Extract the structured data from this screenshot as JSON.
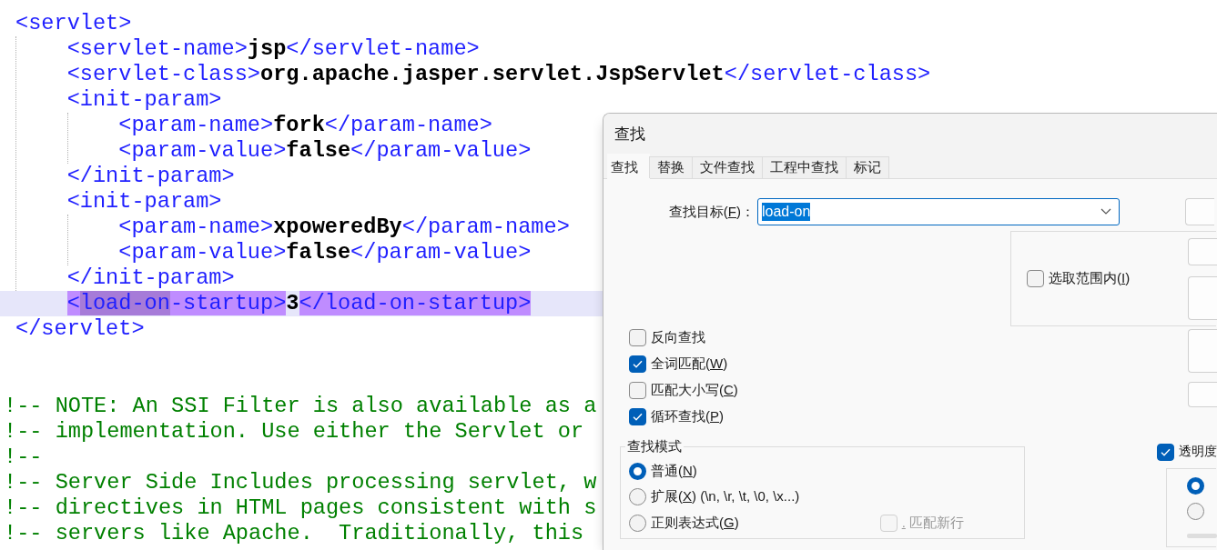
{
  "editor": {
    "lines": [
      {
        "current": false,
        "segments": [
          {
            "kind": "tag",
            "text": "<servlet>"
          }
        ],
        "children": [
          {
            "current": false,
            "segments": [
              {
                "kind": "tag",
                "text": "<servlet-name>"
              },
              {
                "kind": "value",
                "text": "jsp"
              },
              {
                "kind": "tag",
                "text": "</servlet-name>"
              }
            ]
          },
          {
            "current": false,
            "segments": [
              {
                "kind": "tag",
                "text": "<servlet-class>"
              },
              {
                "kind": "value",
                "text": "org.apache.jasper.servlet.JspServlet"
              },
              {
                "kind": "tag",
                "text": "</servlet-class>"
              }
            ]
          },
          {
            "current": false,
            "segments": [
              {
                "kind": "tag",
                "text": "<init-param>"
              }
            ],
            "children": [
              {
                "current": false,
                "segments": [
                  {
                    "kind": "tag",
                    "text": "<param-name>"
                  },
                  {
                    "kind": "value",
                    "text": "fork"
                  },
                  {
                    "kind": "tag",
                    "text": "</param-name>"
                  }
                ]
              },
              {
                "current": false,
                "segments": [
                  {
                    "kind": "tag",
                    "text": "<param-value>"
                  },
                  {
                    "kind": "value",
                    "text": "false"
                  },
                  {
                    "kind": "tag",
                    "text": "</param-value>"
                  }
                ]
              }
            ]
          },
          {
            "current": false,
            "segments": [
              {
                "kind": "tag",
                "text": "</init-param>"
              }
            ]
          },
          {
            "current": false,
            "segments": [
              {
                "kind": "tag",
                "text": "<init-param>"
              }
            ],
            "children": [
              {
                "current": false,
                "segments": [
                  {
                    "kind": "tag",
                    "text": "<param-name>"
                  },
                  {
                    "kind": "value",
                    "text": "xpoweredBy"
                  },
                  {
                    "kind": "tag",
                    "text": "</param-name>"
                  }
                ]
              },
              {
                "current": false,
                "segments": [
                  {
                    "kind": "tag",
                    "text": "<param-value>"
                  },
                  {
                    "kind": "value",
                    "text": "false"
                  },
                  {
                    "kind": "tag",
                    "text": "</param-value>"
                  }
                ]
              }
            ]
          },
          {
            "current": false,
            "segments": [
              {
                "kind": "tag",
                "text": "</init-param>"
              }
            ]
          },
          {
            "current": true,
            "segments": [
              {
                "kind": "tag",
                "text": "<",
                "highlighted": true,
                "current_match": false
              },
              {
                "kind": "tag",
                "text": "load-on",
                "highlighted": true,
                "current_match": true
              },
              {
                "kind": "tag",
                "text": "-startup>",
                "highlighted": true,
                "current_match": false
              },
              {
                "kind": "value",
                "text": "3",
                "highlighted": false,
                "current_match": false
              },
              {
                "kind": "tag",
                "text": "</load-on-startup>",
                "highlighted": true,
                "current_match": false
              }
            ]
          }
        ]
      },
      {
        "current": false,
        "segments": [
          {
            "kind": "tag",
            "text": "</servlet>"
          }
        ]
      }
    ],
    "comment_lines": [
      "!-- NOTE: An SSI Filter is also available as a",
      "!-- implementation. Use either the Servlet or",
      "!--",
      "!-- Server Side Includes processing servlet, w",
      "!-- directives in HTML pages consistent with s",
      "!-- servers like Apache.  Traditionally, this"
    ]
  },
  "dialog": {
    "title": "查找",
    "tabs": [
      {
        "label": "查找",
        "selected": true
      },
      {
        "label": "替换",
        "selected": false
      },
      {
        "label": "文件查找",
        "selected": false
      },
      {
        "label": "工程中查找",
        "selected": false
      },
      {
        "label": "标记",
        "selected": false
      }
    ],
    "find_what": {
      "label": [
        {
          "text": "查找目标("
        },
        {
          "text": "F",
          "underline": true
        },
        {
          "text": ")："
        }
      ],
      "value": "load-on",
      "value_selected": true
    },
    "in_selection": {
      "label": [
        {
          "text": "选取范围内("
        },
        {
          "text": "I",
          "underline": true
        },
        {
          "text": ")"
        }
      ],
      "checked": false
    },
    "side_buttons": [
      {
        "kind": "plain"
      },
      {
        "kind": "plain"
      },
      {
        "kind": "tall"
      },
      {
        "kind": "tall"
      },
      {
        "kind": "short"
      }
    ],
    "options": [
      {
        "label": [
          {
            "text": "反向查找"
          }
        ],
        "checked": false
      },
      {
        "label": [
          {
            "text": "全词匹配("
          },
          {
            "text": "W",
            "underline": true
          },
          {
            "text": ")"
          }
        ],
        "checked": true
      },
      {
        "label": [
          {
            "text": "匹配大小写("
          },
          {
            "text": "C",
            "underline": true
          },
          {
            "text": ")"
          }
        ],
        "checked": false
      },
      {
        "label": [
          {
            "text": "循环查找("
          },
          {
            "text": "P",
            "underline": true
          },
          {
            "text": ")"
          }
        ],
        "checked": true
      }
    ],
    "search_mode": {
      "title": "查找模式",
      "options": [
        {
          "label": [
            {
              "text": "普通("
            },
            {
              "text": "N",
              "underline": true
            },
            {
              "text": ")"
            }
          ],
          "selected": true
        },
        {
          "label": [
            {
              "text": "扩展("
            },
            {
              "text": "X",
              "underline": true
            },
            {
              "text": ") (\\n, \\r, \\t, \\0, \\x...)"
            }
          ],
          "selected": false
        },
        {
          "label": [
            {
              "text": "正则表达式("
            },
            {
              "text": "G",
              "underline": true
            },
            {
              "text": ")"
            }
          ],
          "selected": false
        }
      ],
      "dot_matches_newline": {
        "label": [
          {
            "text": ".",
            "underline": true
          },
          {
            "text": " 匹配新行"
          }
        ],
        "checked": false,
        "disabled": true
      }
    },
    "transparency": {
      "label": [
        {
          "text": "透明度"
        }
      ],
      "checked": true,
      "options": [
        {
          "selected": true
        },
        {
          "selected": false
        }
      ]
    }
  }
}
